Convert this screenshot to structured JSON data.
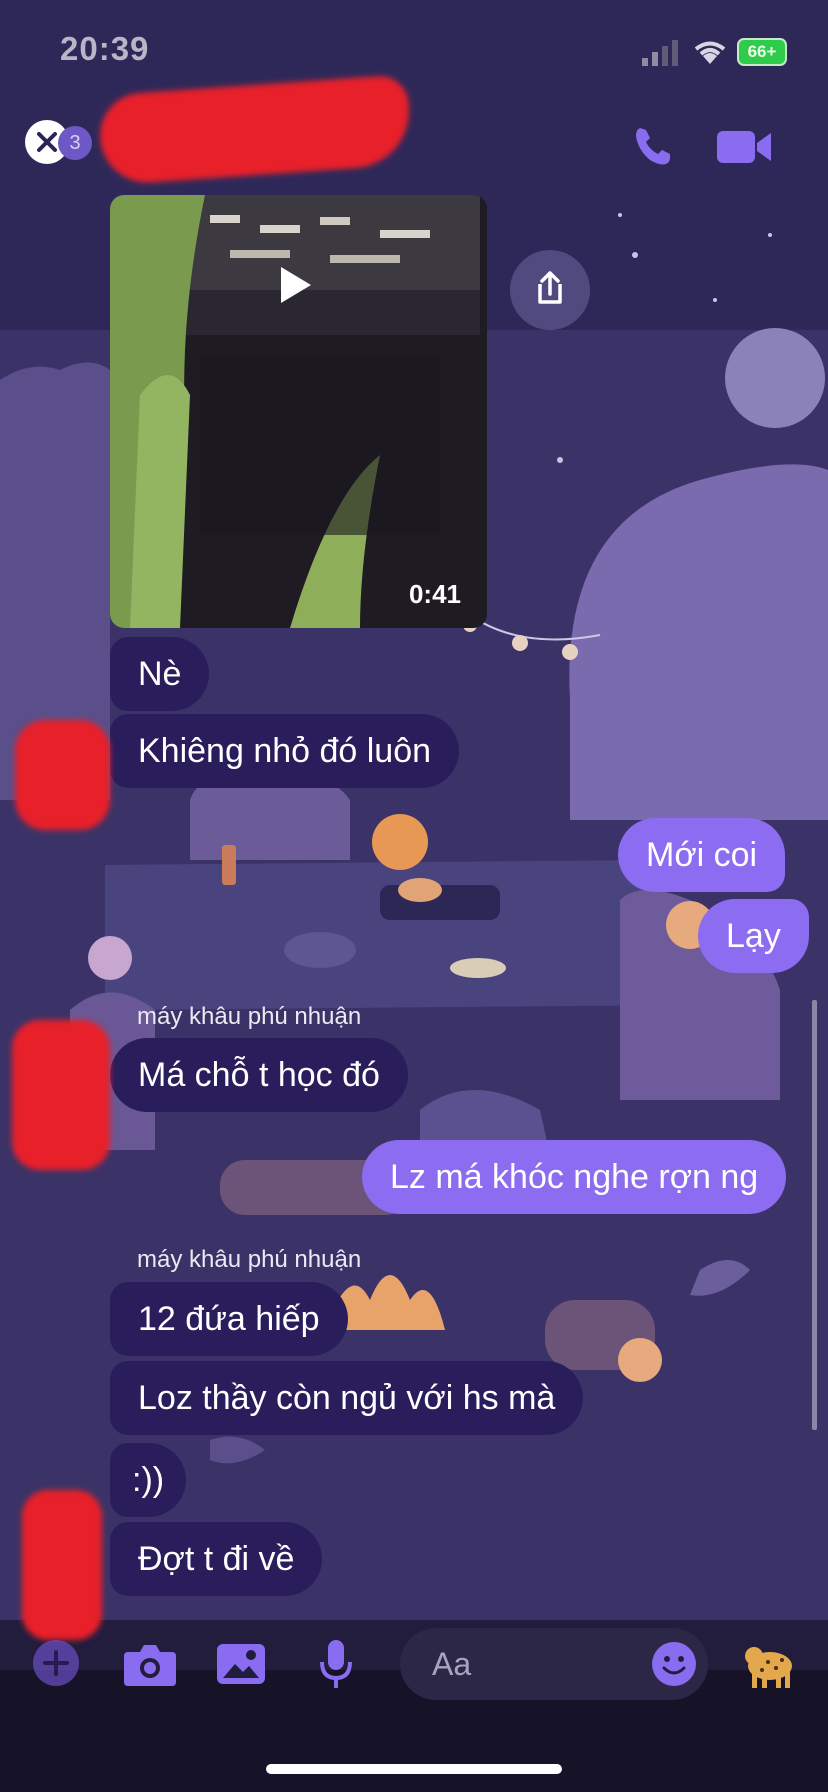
{
  "status_bar": {
    "time": "20:39",
    "battery": "66+"
  },
  "header": {
    "back_count": "3"
  },
  "video": {
    "duration": "0:41"
  },
  "messages": [
    {
      "text": "Nè"
    },
    {
      "text": "Khiêng nhỏ đó luôn"
    },
    {
      "text": "Mới coi"
    },
    {
      "text": "Lạy"
    },
    {
      "text": "Má chỗ t học đó"
    },
    {
      "text": "Lz má khóc nghe rợn ng"
    },
    {
      "text": "12 đứa hiếp"
    },
    {
      "text": "Loz thầy còn ngủ với hs mà"
    },
    {
      "text": ":))"
    },
    {
      "text": "Đợt t đi về"
    }
  ],
  "senders": [
    "máy khâu phú nhuận",
    "máy khâu phú nhuận"
  ],
  "composer": {
    "placeholder": "Aa"
  },
  "colors": {
    "incoming_bubble": "#2a1d5c",
    "outgoing_bubble": "#8c6cf0",
    "accent": "#8a6cf0"
  }
}
